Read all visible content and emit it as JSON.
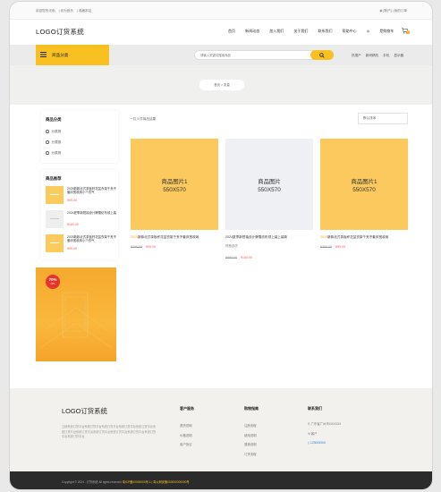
{
  "topbar": {
    "links": [
      "欢迎您的光临",
      "设为首页",
      "收藏本站"
    ],
    "account": "[账户] | 我的订单"
  },
  "header": {
    "logo": "LOGO订货系统",
    "nav": [
      "首页",
      "新闻动态",
      "加入我们",
      "关于我们",
      "联系我们",
      "帮助中心"
    ],
    "cart_label": "是购物车",
    "cart_count": "0"
  },
  "category_bar": {
    "button_label": "商品分类",
    "search_placeholder": "请输入关键词搜索商品",
    "hot_words": [
      "热搜产",
      "新研精机",
      "手机",
      "显示器"
    ]
  },
  "breadcrumb": "首页 > 变量",
  "sidebar": {
    "category_title": "商品分类",
    "categories": [
      "分类测",
      "分类测",
      "分类测"
    ],
    "hot_title": "商品推荐",
    "hot_items": [
      {
        "title": "2025新款北式茶板杯花盆衣架千夹不套床宽收纳小个衣气",
        "price": "¥99.00"
      },
      {
        "title": "2024夏季新短袖设计牌雪纺布领上装",
        "price": "¥180.00"
      },
      {
        "title": "2025新款北式茶板杯花盆衣架千夹不套床宽收纳小个衣气",
        "price": "¥99.00"
      }
    ],
    "promo_badge": "70%",
    "promo_badge_sub": "OFF"
  },
  "toolbar": {
    "count_text": "一共 3 件商品结果",
    "sort_label": "默认排序"
  },
  "products": [
    {
      "img_line1": "商品图片1",
      "img_line2": "550X570",
      "year": "2025",
      "title": "新款北式茶板杯花盆衣架千夹不套床宽收纳",
      "sub": "",
      "old_price": "¥380.00",
      "price": "¥99.00",
      "img_style": "yellow"
    },
    {
      "img_line1": "商品图片",
      "img_line2": "550X570",
      "year": "",
      "title": "2024夏季新短袖设计牌雪纺布领上装上装款",
      "sub": "规格选项",
      "old_price": "¥980.00",
      "price": "¥180.00",
      "img_style": "gray"
    },
    {
      "img_line1": "商品图片1",
      "img_line2": "550X570",
      "year": "2025",
      "title": "新款北式茶板杯花盆衣架千夹不套床宽收纳",
      "sub": "",
      "old_price": "¥380.00",
      "price": "¥99.00",
      "img_style": "yellow"
    }
  ],
  "footer": {
    "logo": "LOGO订货系统",
    "desc": "立销系统订货平台系统订货平台系统订货平台系统订货平台系统订货平台系统订货平台系统订货平台系统订货平台系统订货平台系统订货平台系统订货平台系统订货平台",
    "col1_title": "客户服务",
    "col1_items": [
      "退货说明",
      "价格说明",
      "用户协议"
    ],
    "col2_title": "购物指南",
    "col2_items": [
      "注册流程",
      "使用说明",
      "退换说明",
      "订货流程"
    ],
    "col3_title": "联系我们",
    "address": "广东省广州市XXXXXX",
    "email": "客户",
    "phone": "123000000",
    "copyright_prefix": "Copyright © 2024 - 订货系统 All rights reserved",
    "icp": "粤ICP备00000000号-1 | 粤公网安备000000000000号"
  }
}
